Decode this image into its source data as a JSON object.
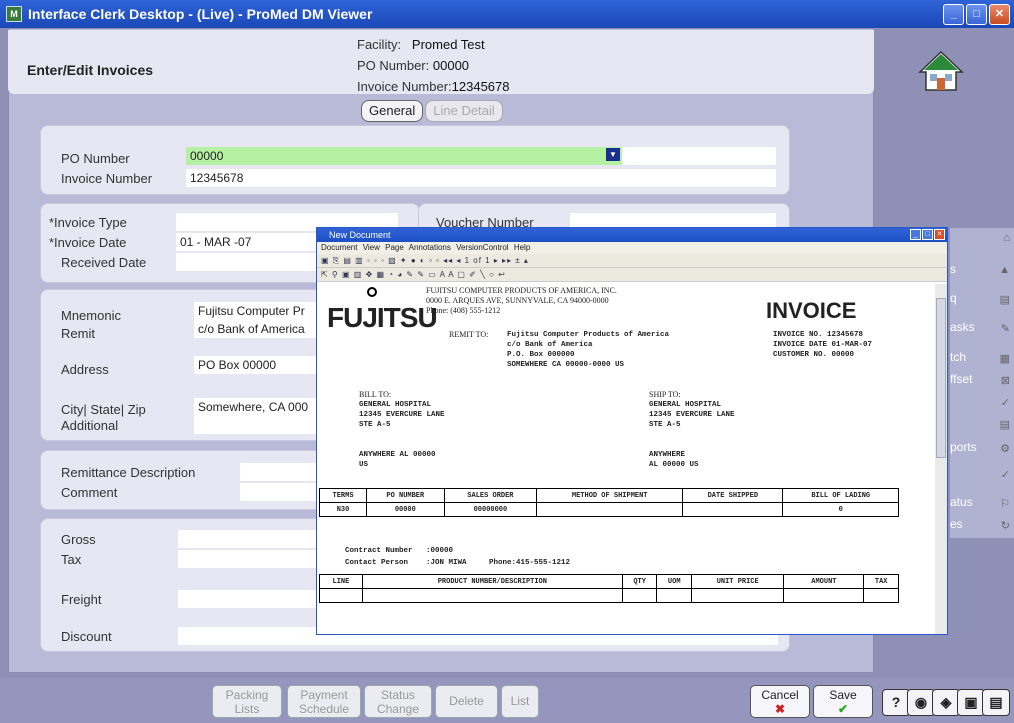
{
  "window": {
    "title": "Interface Clerk Desktop - (Live) - ProMed DM Viewer"
  },
  "header": {
    "title": "Enter/Edit Invoices",
    "facility_label": "Facility:",
    "facility_value": "Promed Test",
    "po_label": "PO Number:",
    "po_value": "00000",
    "invoice_label": "Invoice Number:",
    "invoice_value": "12345678"
  },
  "tabs": [
    {
      "label": "General"
    },
    {
      "label": "Line Detail"
    }
  ],
  "form": {
    "po_number_label": "PO Number",
    "po_number_value": "00000",
    "invoice_number_label": "Invoice Number",
    "invoice_number_value": "12345678",
    "invoice_type_label": "*Invoice Type",
    "invoice_date_label": "*Invoice Date",
    "invoice_date_value": "01 - MAR -07",
    "received_date_label": "Received Date",
    "voucher_number_label": "Voucher Number",
    "mnemonic_label": "Mnemonic",
    "mnemonic_value": "Fujitsu Computer Pr",
    "remit_label": "Remit",
    "remit_value": "c/o Bank of America",
    "address_label": "Address",
    "address_value": "PO Box 00000",
    "city_label": "City| State| Zip",
    "city_value": "Somewhere, CA 000",
    "additional_label": "Additional",
    "remittance_label": "Remittance Description",
    "comment_label": "Comment",
    "gross_label": "Gross",
    "tax_label": "Tax",
    "freight_label": "Freight",
    "discount_label": "Discount"
  },
  "sidebar": {
    "items": [
      {
        "label": ""
      },
      {
        "label": "s"
      },
      {
        "label": "q"
      },
      {
        "label": "asks"
      },
      {
        "label": "tch"
      },
      {
        "label": "ffset"
      },
      {
        "label": ""
      },
      {
        "label": ""
      },
      {
        "label": "ports"
      },
      {
        "label": ""
      },
      {
        "label": "atus"
      },
      {
        "label": "es"
      }
    ]
  },
  "bottom": {
    "packing": "Packing Lists",
    "payment": "Payment Schedule",
    "status": "Status Change",
    "delete": "Delete",
    "list": "List",
    "cancel": "Cancel",
    "save": "Save",
    "help": "?"
  },
  "document": {
    "title": "New Document",
    "menu": [
      "Document",
      "View",
      "Page",
      "Annotations",
      "VersionControl",
      "Help"
    ],
    "page_indicator": "1 of 1",
    "company": "FUJITSU COMPUTER PRODUCTS OF AMERICA, INC.",
    "company_addr": "0000 E. ARQUES AVE, SUNNYVALE, CA 94000-0000",
    "company_phone": "Phone: (408) 555-1212",
    "logo": "FUJITSU",
    "heading": "INVOICE",
    "remit_to_label": "REMIT TO:",
    "remit_lines": [
      "Fujitsu Computer Products of America",
      "c/o Bank of America",
      "P.O. Box 000000",
      "SOMEWHERE CA 00000-0000 US"
    ],
    "inv_no": "INVOICE NO. 12345678",
    "inv_date": "INVOICE DATE 01-MAR-07",
    "cust_no": "CUSTOMER NO. 00000",
    "bill_to_label": "BILL TO:",
    "bill_lines": [
      "GENERAL HOSPITAL",
      "12345 EVERCURE LANE",
      "STE A-5"
    ],
    "ship_to_label": "SHIP TO:",
    "ship_lines": [
      "GENERAL HOSPITAL",
      "12345 EVERCURE LANE",
      "STE A-5"
    ],
    "bill_city": [
      "ANYWHERE AL 00000",
      "US"
    ],
    "ship_city": [
      "ANYWHERE",
      "AL 00000 US"
    ],
    "terms_headers": [
      "TERMS",
      "PO NUMBER",
      "SALES ORDER",
      "METHOD OF SHIPMENT",
      "DATE SHIPPED",
      "BILL OF LADING"
    ],
    "terms_values": [
      "N30",
      "00000",
      "00000000",
      "",
      "",
      "0"
    ],
    "contract": "Contract Number   :00000",
    "contact": "Contact Person    :JON MIWA     Phone:415-555-1212",
    "line_headers": [
      "LINE",
      "PRODUCT NUMBER/DESCRIPTION",
      "QTY",
      "UOM",
      "UNIT PRICE",
      "AMOUNT",
      "TAX"
    ]
  }
}
